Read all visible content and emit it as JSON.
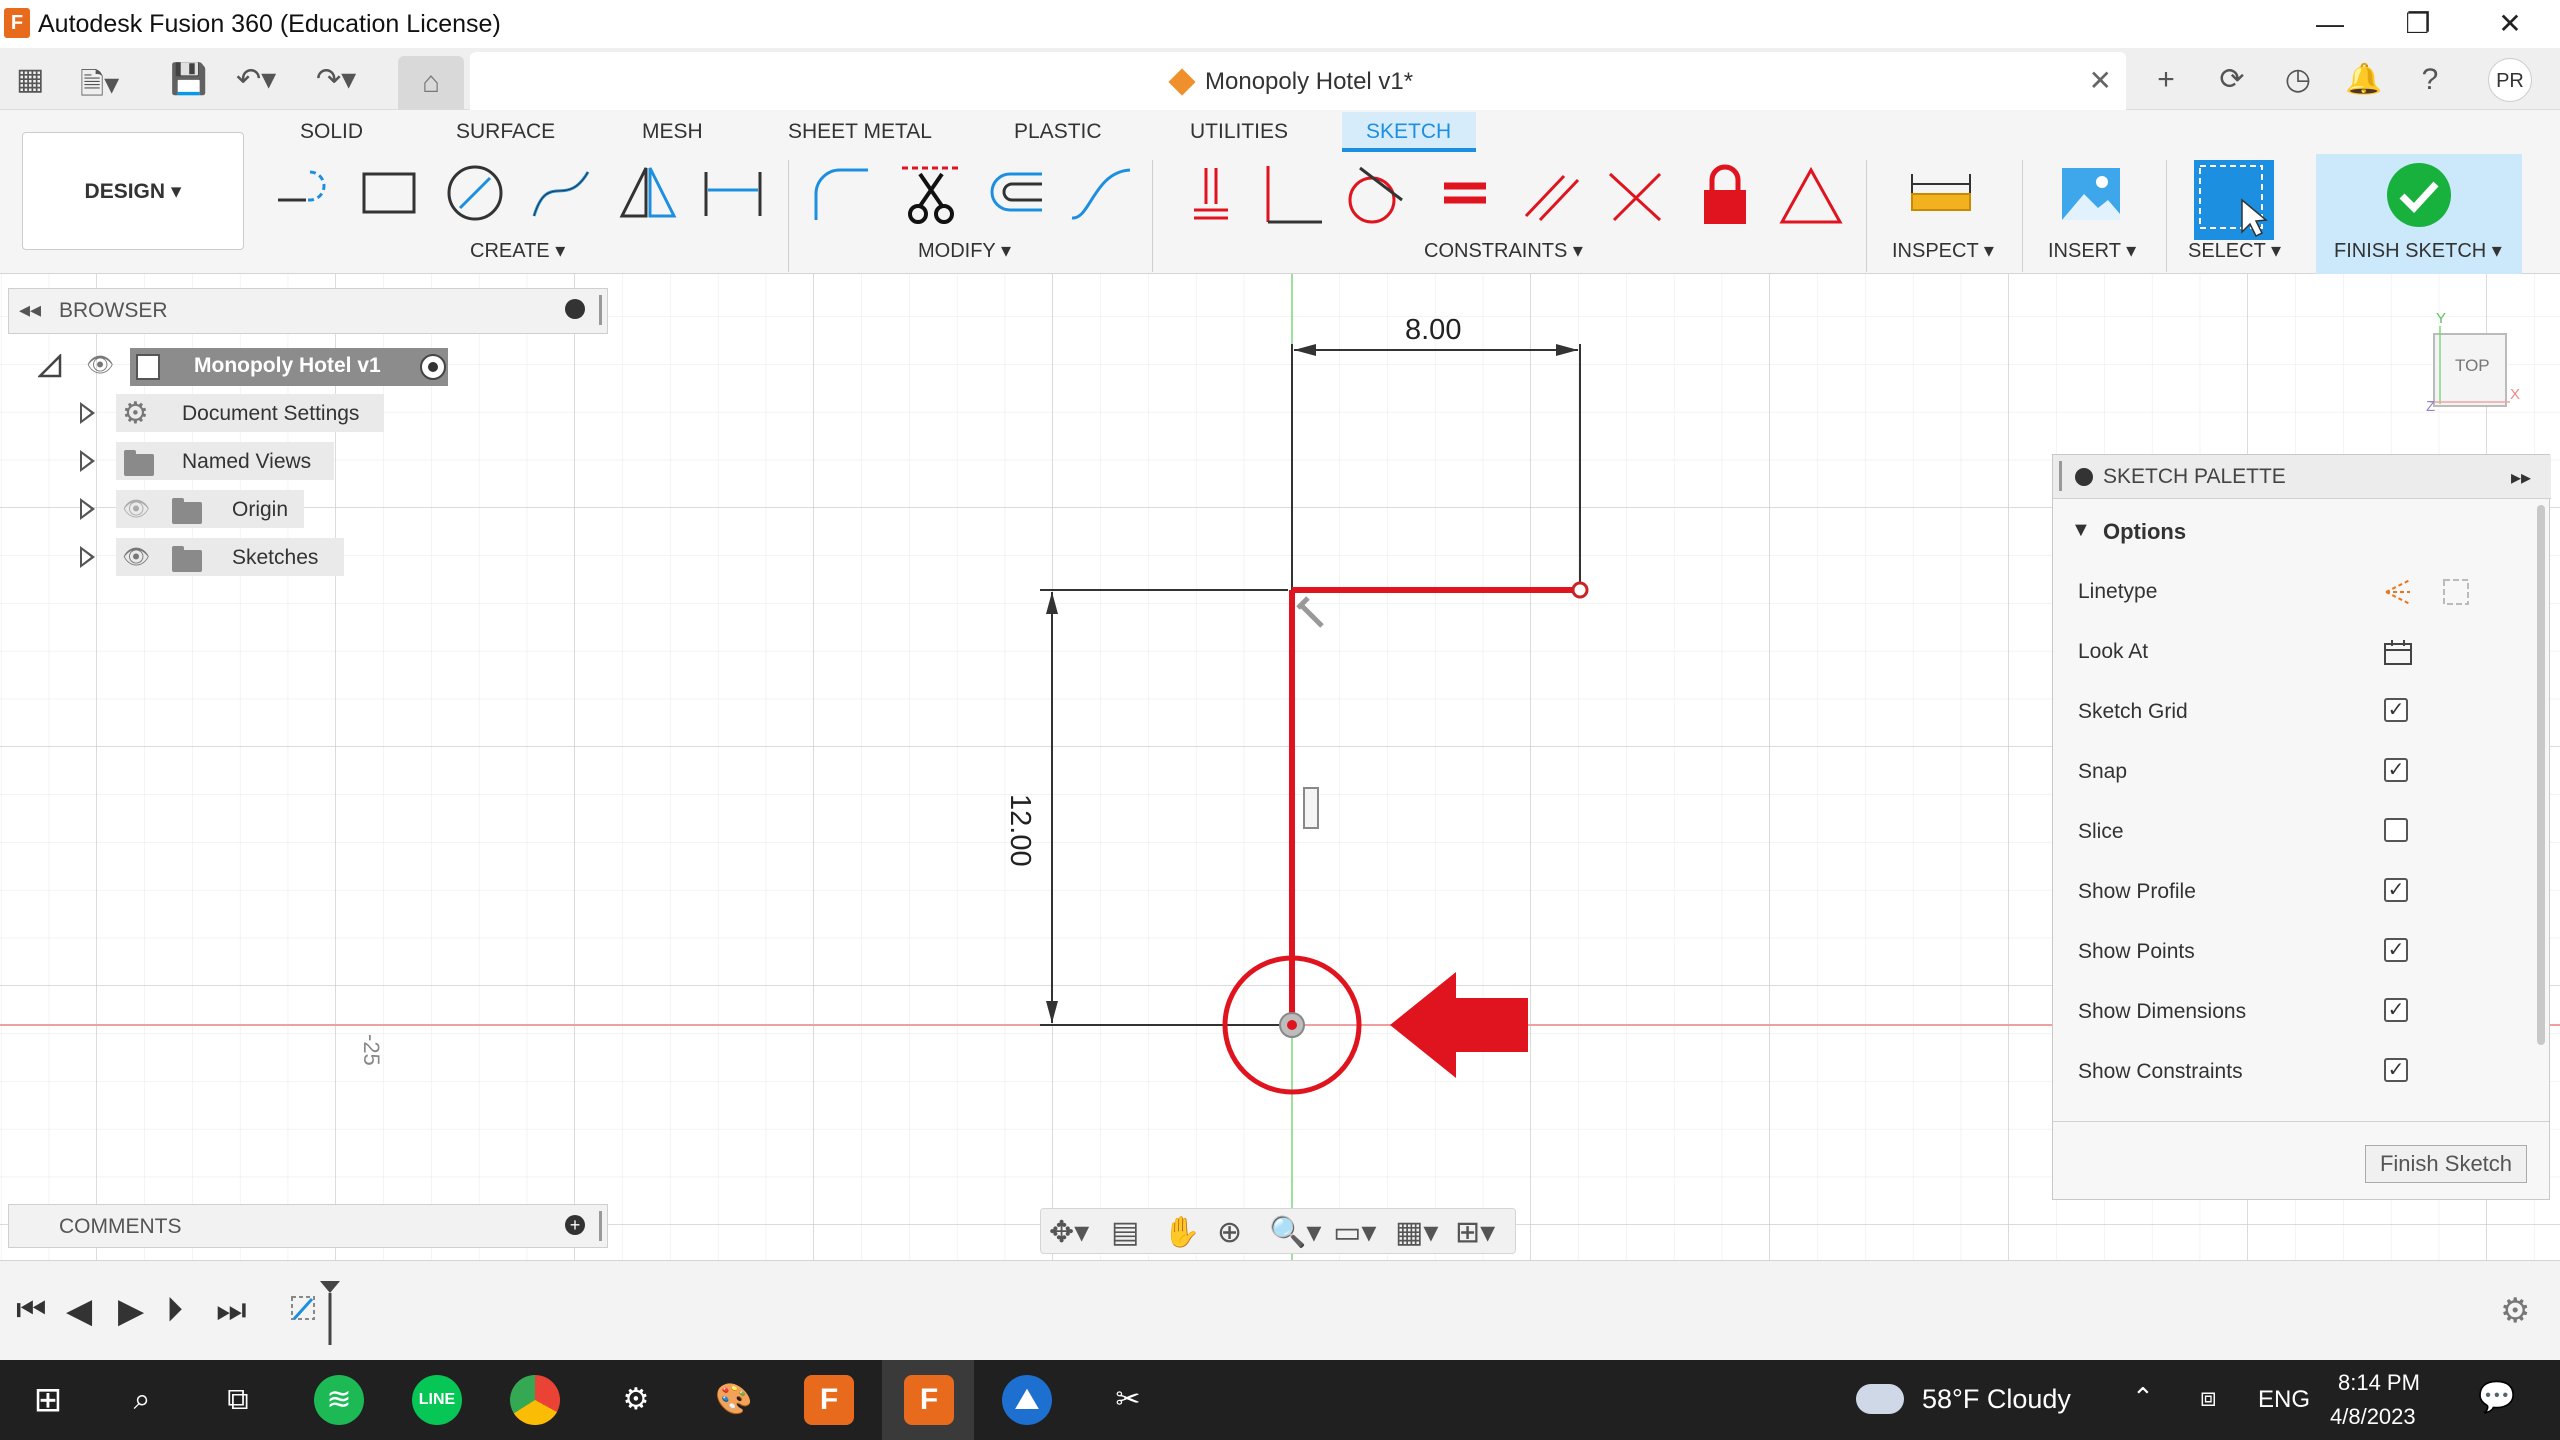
{
  "window": {
    "title": "Autodesk Fusion 360 (Education License)",
    "app_logo": "F"
  },
  "document": {
    "tab_title": "Monopoly Hotel v1*"
  },
  "user": {
    "initials": "PR"
  },
  "ribbon": {
    "tabs": [
      "SOLID",
      "SURFACE",
      "MESH",
      "SHEET METAL",
      "PLASTIC",
      "UTILITIES",
      "SKETCH"
    ],
    "active_tab": "SKETCH",
    "workspace": "DESIGN ▾",
    "groups": {
      "create": "CREATE ▾",
      "modify": "MODIFY ▾",
      "constraints": "CONSTRAINTS ▾",
      "inspect": "INSPECT ▾",
      "insert": "INSERT ▾",
      "select": "SELECT ▾",
      "finish": "FINISH SKETCH ▾"
    }
  },
  "browser": {
    "title": "BROWSER",
    "root": "Monopoly Hotel v1",
    "items": [
      "Document Settings",
      "Named Views",
      "Origin",
      "Sketches"
    ]
  },
  "comments": {
    "title": "COMMENTS"
  },
  "canvas": {
    "dimension_width": "8.00",
    "dimension_height": "12.00",
    "grid_label": "-25",
    "view_cube": "TOP",
    "axis_y": "Y",
    "axis_x": "X",
    "axis_z": "Z"
  },
  "palette": {
    "title": "SKETCH PALETTE",
    "section": "Options",
    "rows": [
      {
        "label": "Linetype",
        "type": "icons"
      },
      {
        "label": "Look At",
        "type": "icon"
      },
      {
        "label": "Sketch Grid",
        "checked": true
      },
      {
        "label": "Snap",
        "checked": true
      },
      {
        "label": "Slice",
        "checked": false
      },
      {
        "label": "Show Profile",
        "checked": true
      },
      {
        "label": "Show Points",
        "checked": true
      },
      {
        "label": "Show Dimensions",
        "checked": true
      },
      {
        "label": "Show Constraints",
        "checked": true
      }
    ],
    "finish_button": "Finish Sketch"
  },
  "taskbar": {
    "weather": "58°F  Cloudy",
    "language": "ENG",
    "time": "8:14 PM",
    "date": "4/8/2023"
  },
  "colors": {
    "sketch_line": "#e0141e",
    "accent": "#1d8fe0",
    "finish_green": "#18b13d",
    "taskbar": "#202020"
  }
}
